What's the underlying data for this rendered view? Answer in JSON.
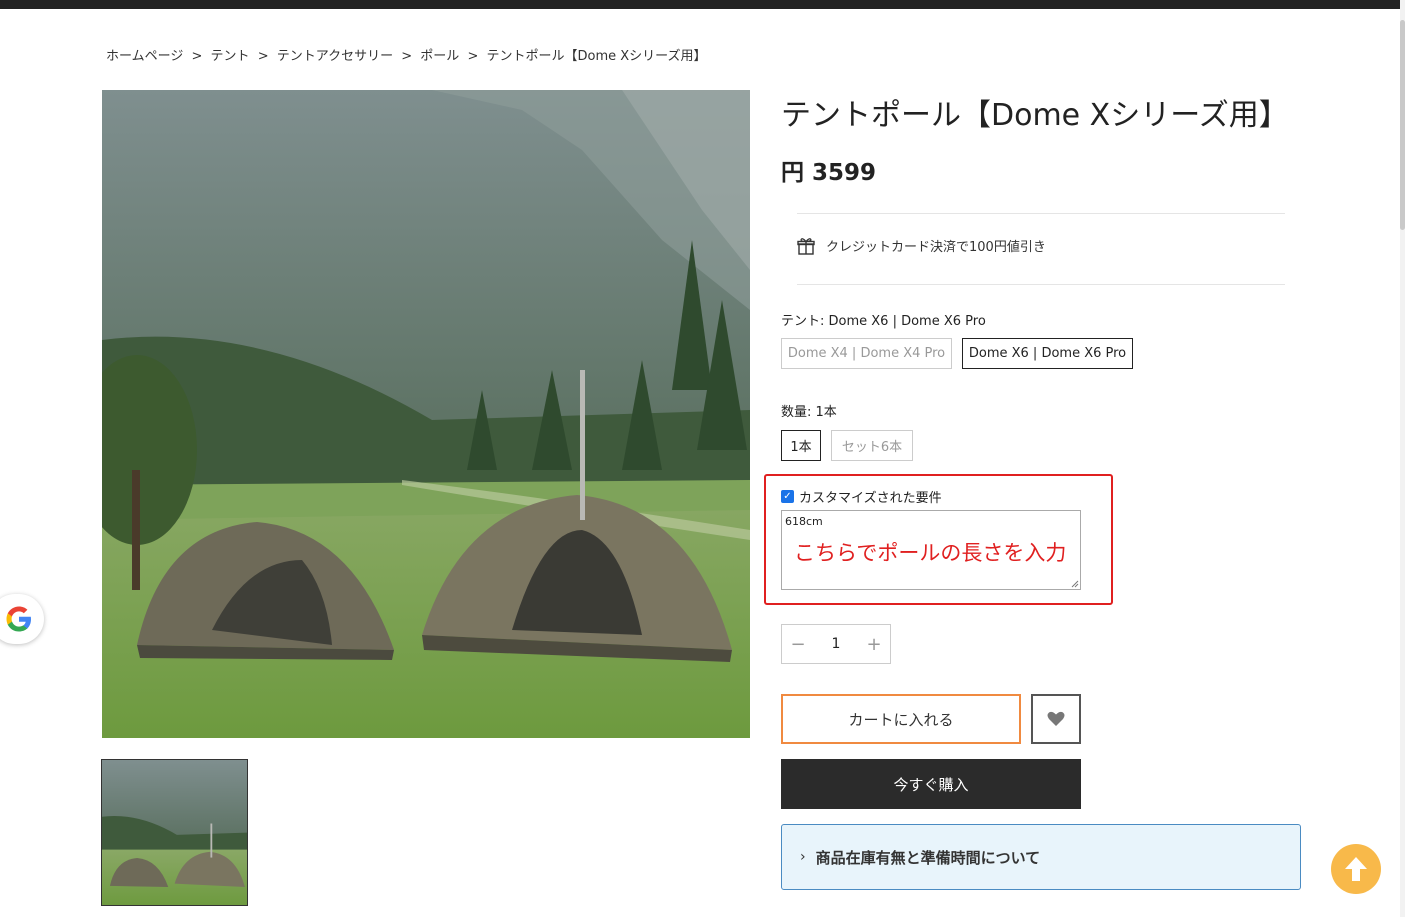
{
  "breadcrumb": [
    "ホームページ",
    ">",
    "テント",
    ">",
    "テントアクセサリー",
    ">",
    "ポール",
    ">",
    "テントポール【Dome Xシリーズ用】"
  ],
  "product": {
    "title": "テントポール【Dome Xシリーズ用】",
    "price": "円 3599"
  },
  "promo": {
    "text": "クレジットカード決済で100円値引き",
    "icon": "gift-icon"
  },
  "tent_option": {
    "label": "テント: Dome X6 | Dome X6 Pro",
    "options": [
      "Dome X4 | Dome X4 Pro",
      "Dome X6 | Dome X6 Pro"
    ],
    "selected": "Dome X6 | Dome X6 Pro"
  },
  "quantity_option": {
    "label": "数量: 1本",
    "options": [
      "1本",
      "セット6本"
    ],
    "selected": "1本"
  },
  "customization": {
    "label": "カスタマイズされた要件",
    "checked": true,
    "value": "618cm",
    "annotation": "こちらでポールの長さを入力"
  },
  "stepper": {
    "minus": "−",
    "value": "1",
    "plus": "+"
  },
  "actions": {
    "add_to_cart": "カートに入れる",
    "buy_now": "今すぐ購入",
    "wishlist_icon": "heart-icon"
  },
  "info": {
    "text": "商品在庫有無と準備時間について",
    "chevron": "›"
  },
  "colors": {
    "accent_orange": "#f08a40",
    "buy_dark": "#2b2b2b",
    "annotation_red": "#e02020",
    "info_bg": "#e8f4fb",
    "to_top": "#f8b94a"
  }
}
